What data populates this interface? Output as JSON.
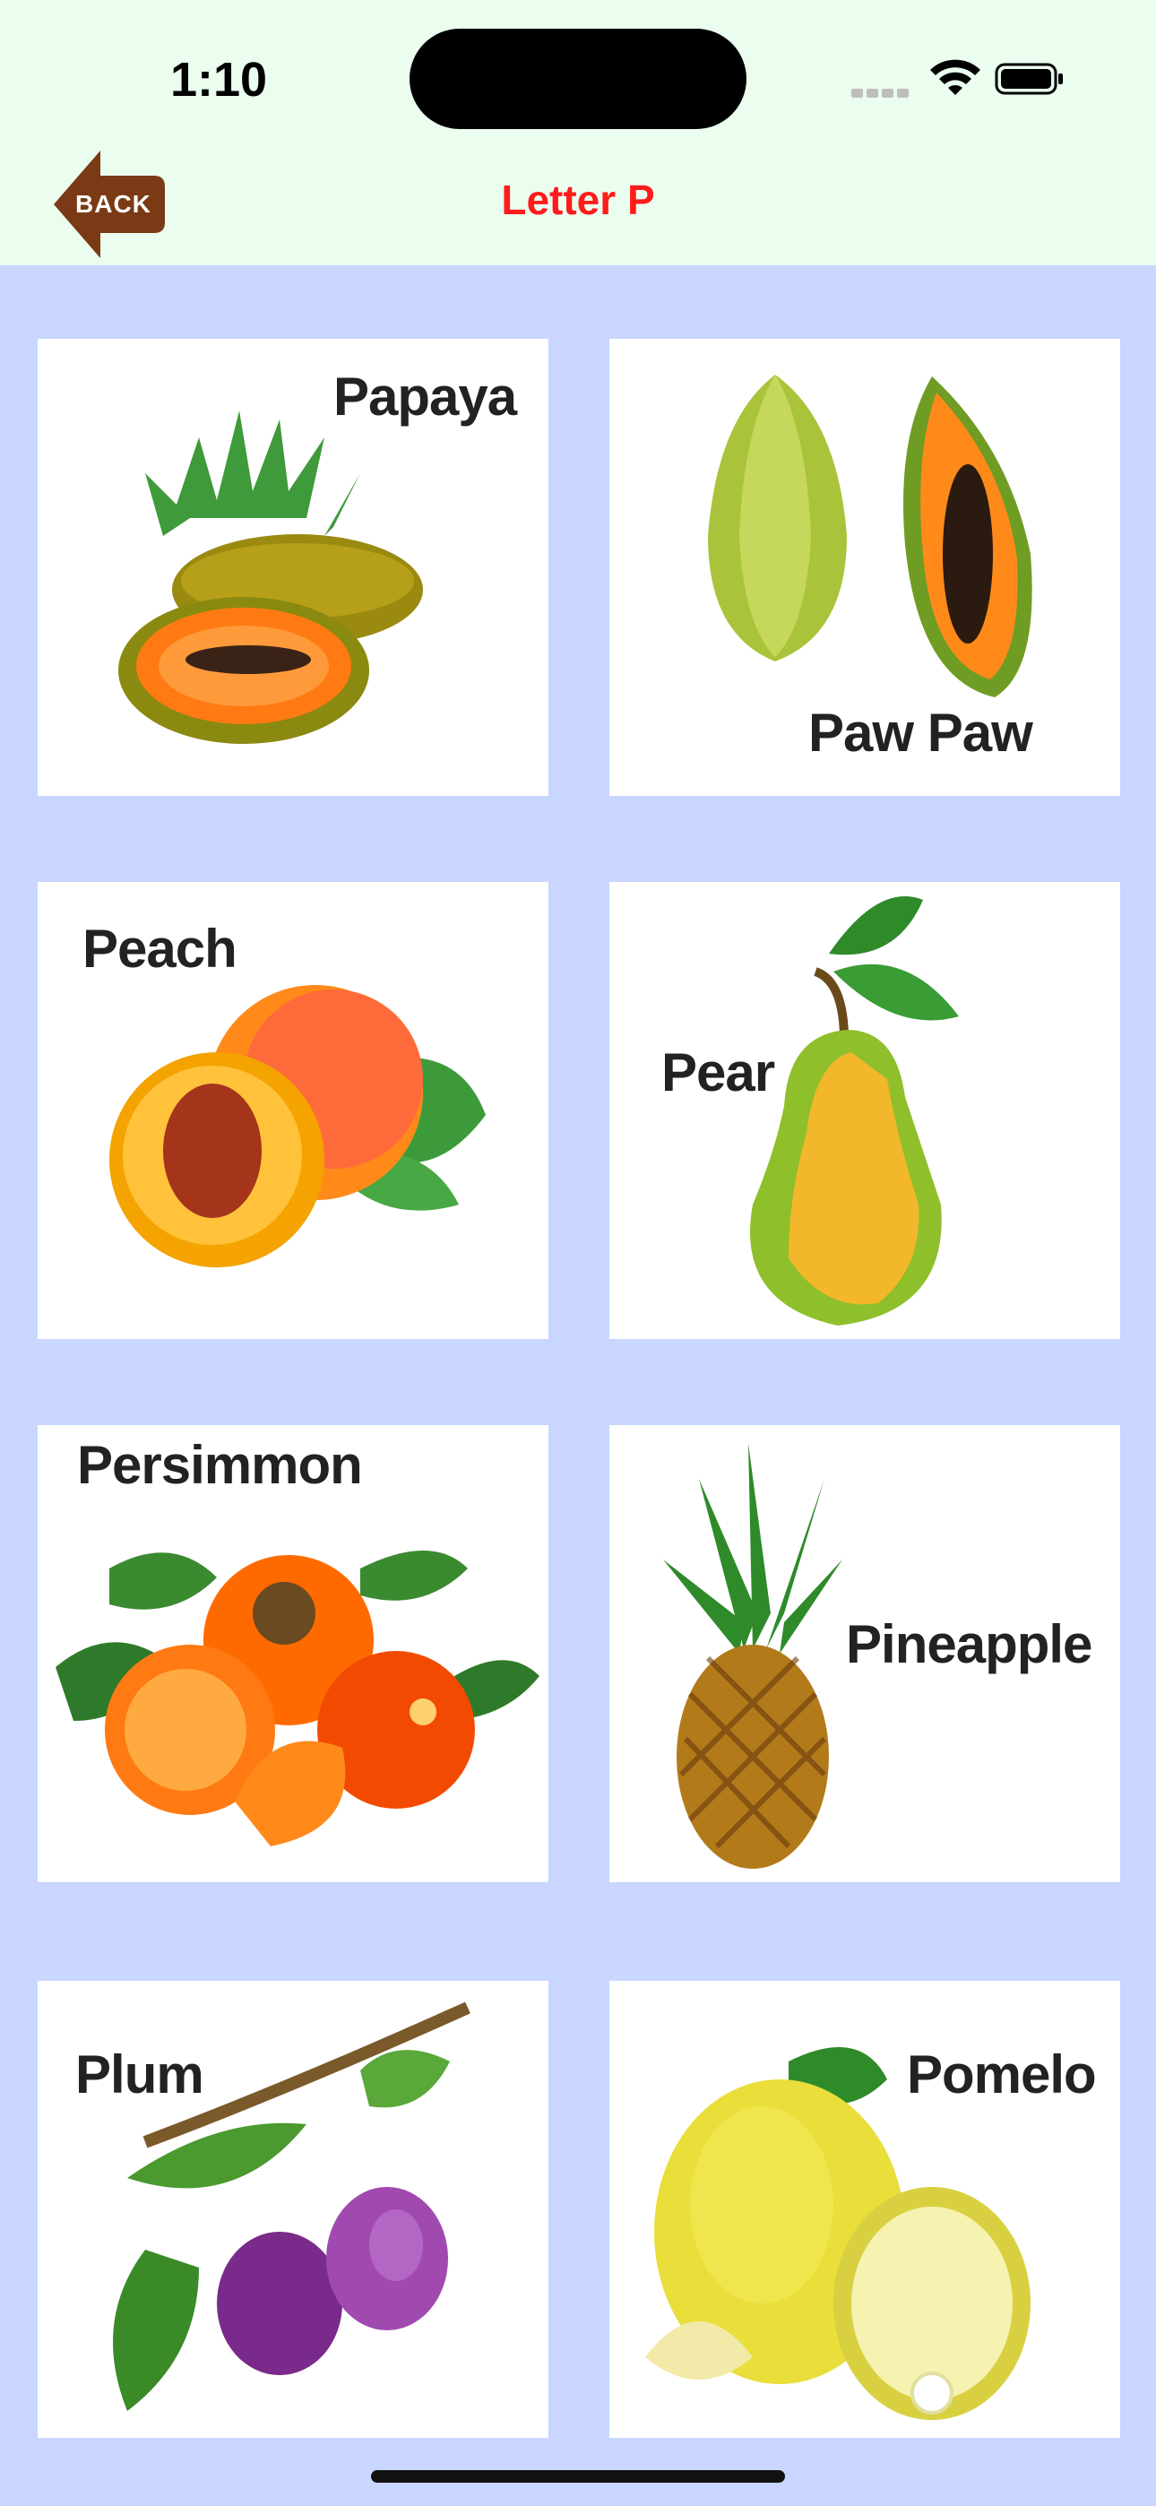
{
  "status_bar": {
    "time": "1:10"
  },
  "header": {
    "back_label": "BACK",
    "title": "Letter P"
  },
  "cards": [
    {
      "label": "Papaya"
    },
    {
      "label": "Paw Paw"
    },
    {
      "label": "Peach"
    },
    {
      "label": "Pear"
    },
    {
      "label": "Persimmon"
    },
    {
      "label": "Pineapple"
    },
    {
      "label": "Plum"
    },
    {
      "label": "Pomelo"
    }
  ],
  "colors": {
    "header_bg": "#eafdef",
    "body_bg": "#c9d6ff",
    "title": "#ff1b1b",
    "back_button": "#7a3a16"
  }
}
